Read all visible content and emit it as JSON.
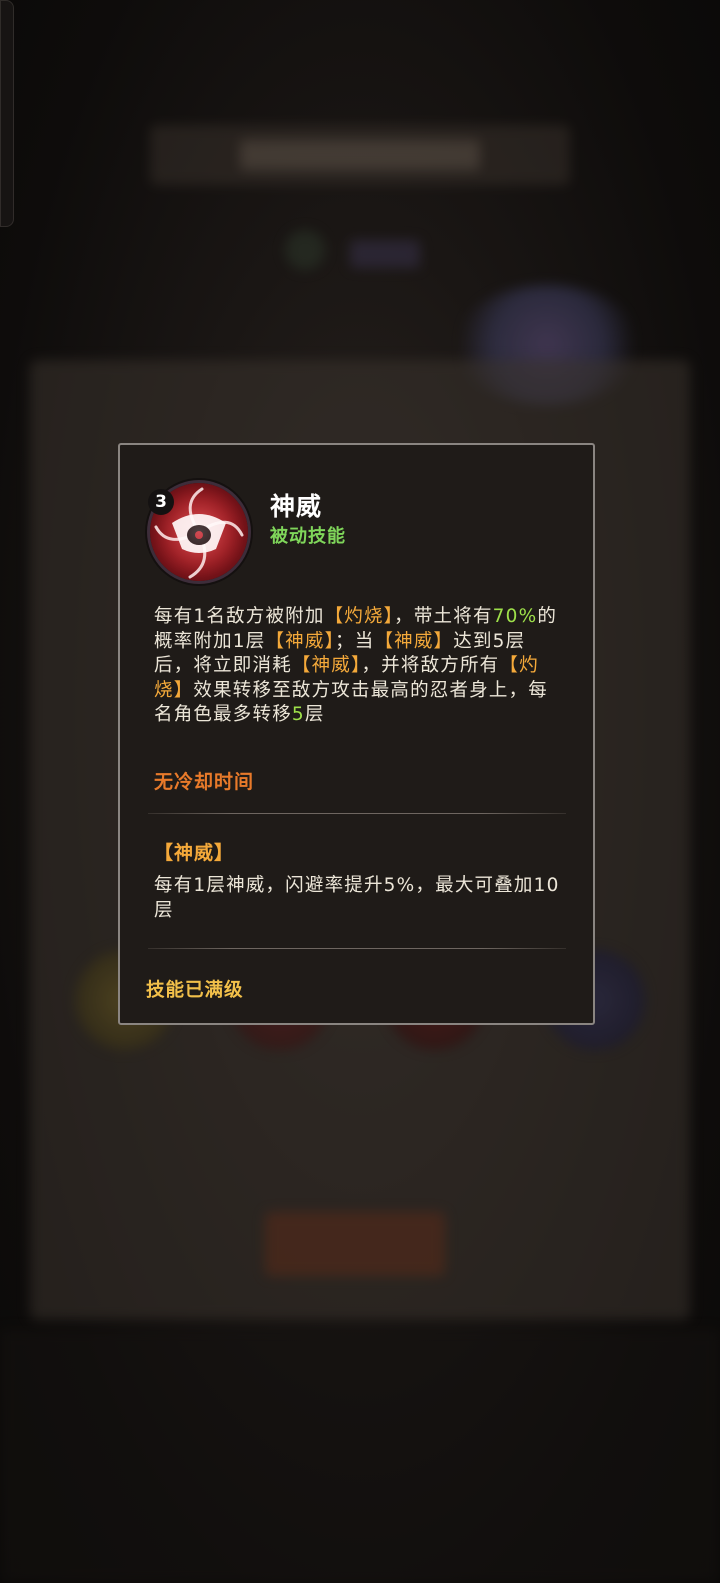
{
  "skill": {
    "level": "3",
    "name": "神威",
    "type": "被动技能",
    "icon": "kamui-eye-icon"
  },
  "description": {
    "segments": [
      {
        "text": "每有1名敌方被附加",
        "style": "normal"
      },
      {
        "text": "【灼烧】",
        "style": "keyword"
      },
      {
        "text": "，带土将有",
        "style": "normal"
      },
      {
        "text": "70%",
        "style": "number"
      },
      {
        "text": "的概率附加1层",
        "style": "normal"
      },
      {
        "text": "【神威】",
        "style": "keyword"
      },
      {
        "text": "；当",
        "style": "normal"
      },
      {
        "text": "【神威】",
        "style": "keyword"
      },
      {
        "text": "达到5层后，将立即消耗",
        "style": "normal"
      },
      {
        "text": "【神威】",
        "style": "keyword"
      },
      {
        "text": "，并将敌方所有",
        "style": "normal"
      },
      {
        "text": "【灼烧】",
        "style": "keyword"
      },
      {
        "text": "效果转移至敌方攻击最高的忍者身上，每名角色最多转移",
        "style": "normal"
      },
      {
        "text": "5",
        "style": "number"
      },
      {
        "text": "层",
        "style": "normal"
      }
    ]
  },
  "cooldown": "无冷却时间",
  "buff": {
    "title": "【神威】",
    "description": "每有1层神威，闪避率提升5%，最大可叠加10层"
  },
  "status": "技能已满级",
  "colors": {
    "keyword": "#f4a93a",
    "number": "#9ee04a",
    "type": "#7fd65a",
    "cooldown": "#e87a2a",
    "status": "#f2c04a",
    "card_border": "#8a8581"
  }
}
